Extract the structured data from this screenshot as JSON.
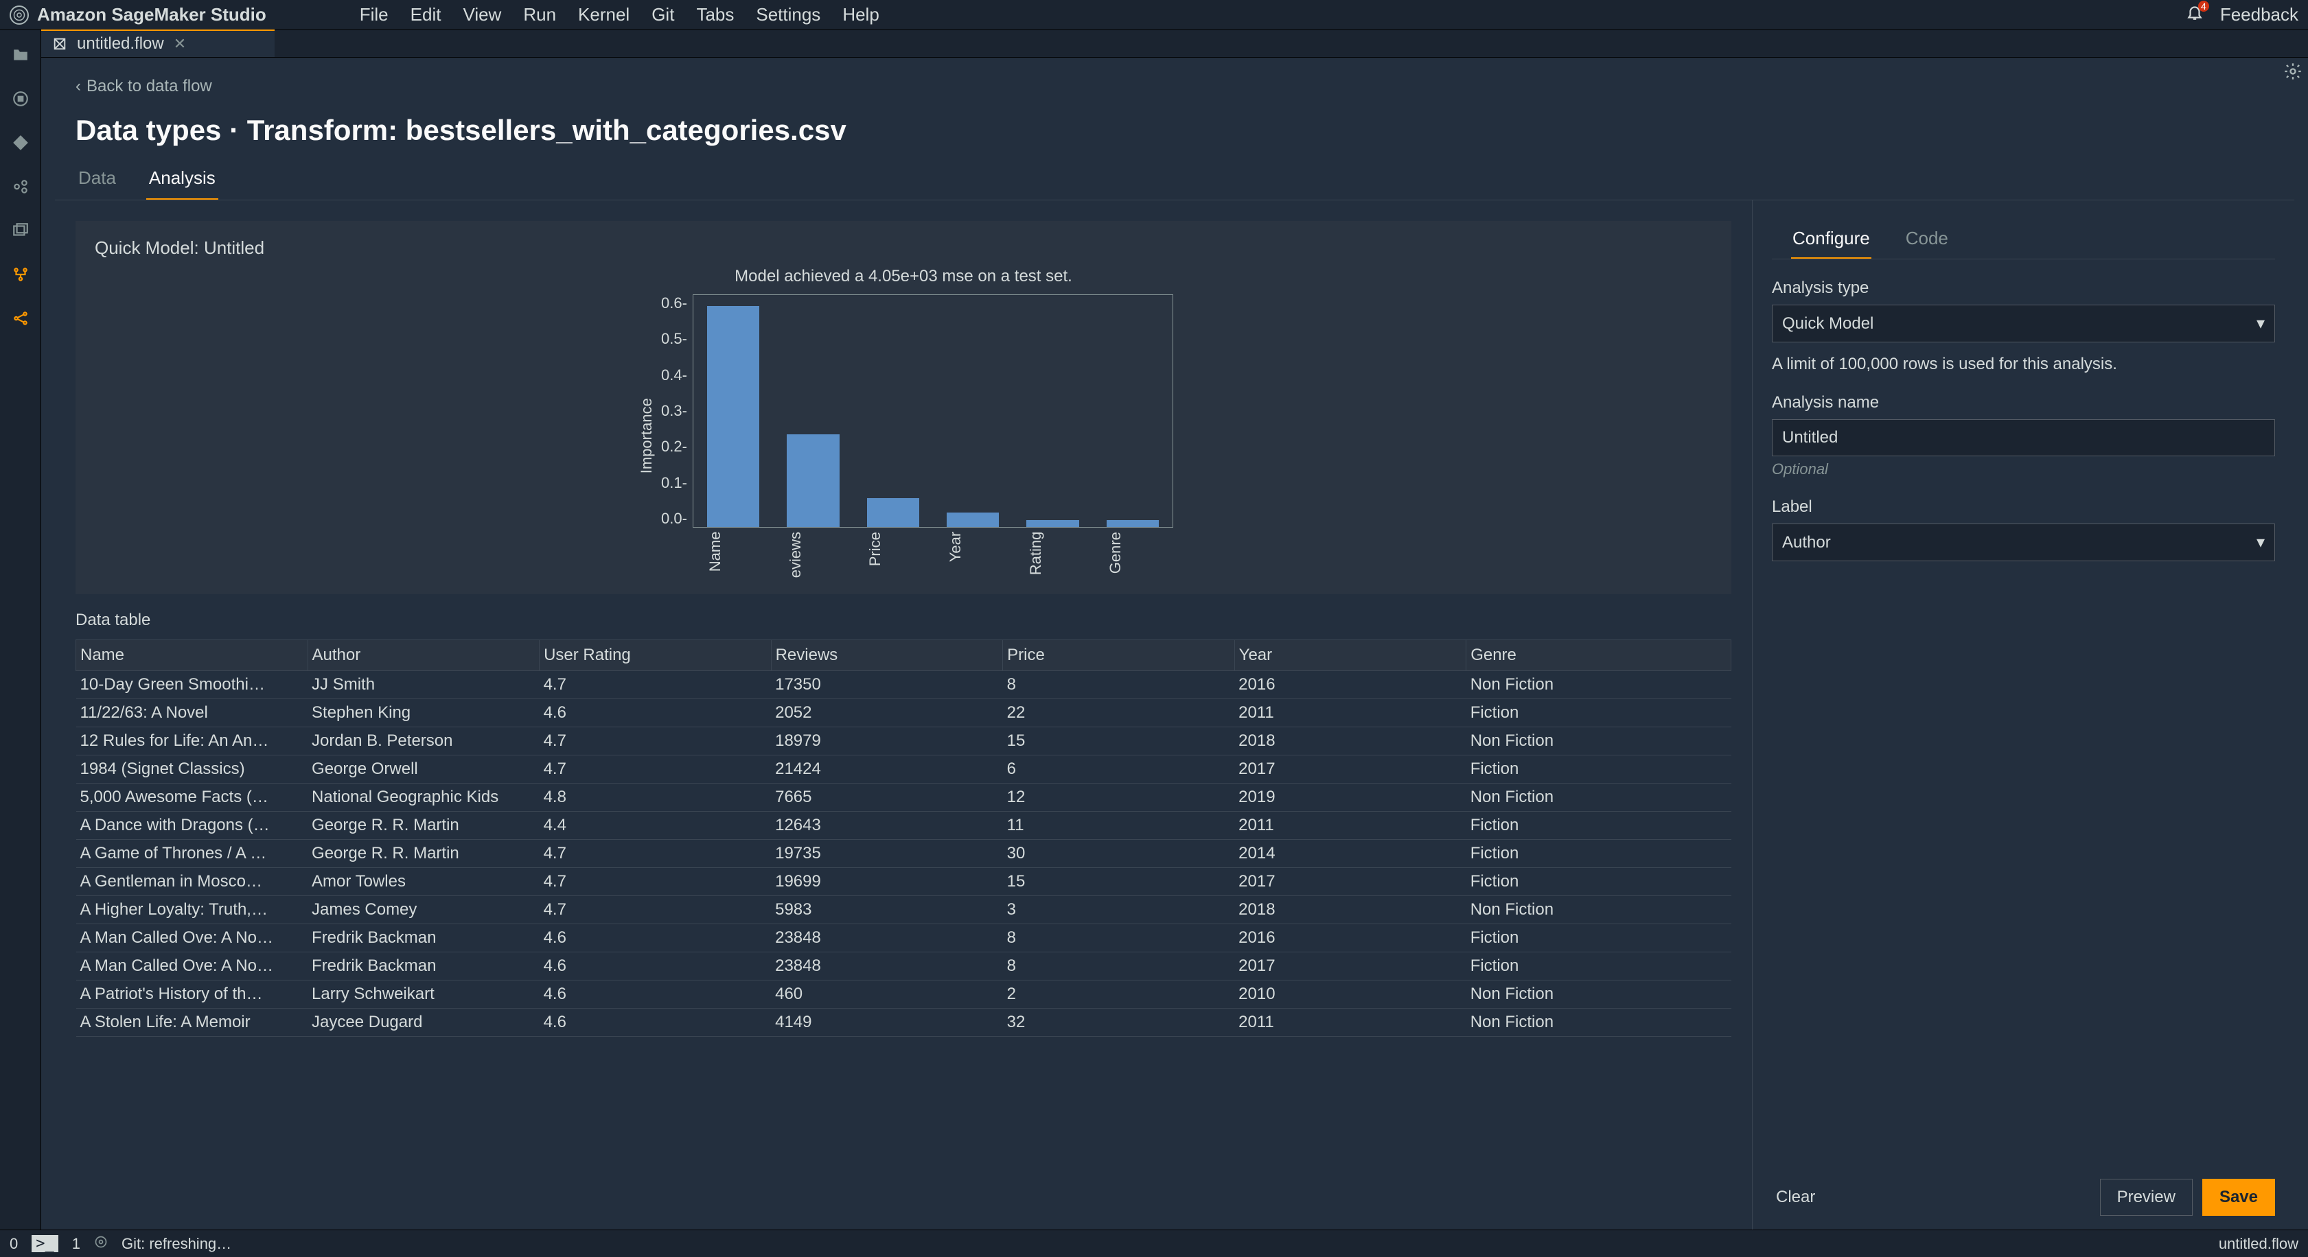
{
  "menubar": {
    "app_title": "Amazon SageMaker Studio",
    "items": [
      "File",
      "Edit",
      "View",
      "Run",
      "Kernel",
      "Git",
      "Tabs",
      "Settings",
      "Help"
    ],
    "notif_count": "4",
    "feedback": "Feedback"
  },
  "tab": {
    "label": "untitled.flow"
  },
  "backlink": "Back to data flow",
  "page_title": "Data types · Transform: bestsellers_with_categories.csv",
  "subtabs": {
    "data": "Data",
    "analysis": "Analysis"
  },
  "quick_model_title": "Quick Model: Untitled",
  "chart_caption": "Model achieved a 4.05e+03 mse on a test set.",
  "chart_data": {
    "type": "bar",
    "categories": [
      "Name",
      "eviews",
      "Price",
      "Year",
      "Rating",
      "Genre"
    ],
    "values": [
      0.62,
      0.26,
      0.08,
      0.04,
      0.02,
      0.02
    ],
    "ylabel": "Importance",
    "ylim": [
      0.0,
      0.6
    ],
    "yticks": [
      "0.6-",
      "0.5-",
      "0.4-",
      "0.3-",
      "0.2-",
      "0.1-",
      "0.0-"
    ]
  },
  "data_table_label": "Data table",
  "columns": [
    "Name",
    "Author",
    "User Rating",
    "Reviews",
    "Price",
    "Year",
    "Genre"
  ],
  "rows": [
    [
      "10-Day Green Smoothi…",
      "JJ Smith",
      "4.7",
      "17350",
      "8",
      "2016",
      "Non Fiction"
    ],
    [
      "11/22/63: A Novel",
      "Stephen King",
      "4.6",
      "2052",
      "22",
      "2011",
      "Fiction"
    ],
    [
      "12 Rules for Life: An An…",
      "Jordan B. Peterson",
      "4.7",
      "18979",
      "15",
      "2018",
      "Non Fiction"
    ],
    [
      "1984 (Signet Classics)",
      "George Orwell",
      "4.7",
      "21424",
      "6",
      "2017",
      "Fiction"
    ],
    [
      "5,000 Awesome Facts (…",
      "National Geographic Kids",
      "4.8",
      "7665",
      "12",
      "2019",
      "Non Fiction"
    ],
    [
      "A Dance with Dragons (…",
      "George R. R. Martin",
      "4.4",
      "12643",
      "11",
      "2011",
      "Fiction"
    ],
    [
      "A Game of Thrones / A …",
      "George R. R. Martin",
      "4.7",
      "19735",
      "30",
      "2014",
      "Fiction"
    ],
    [
      "A Gentleman in Mosco…",
      "Amor Towles",
      "4.7",
      "19699",
      "15",
      "2017",
      "Fiction"
    ],
    [
      "A Higher Loyalty: Truth,…",
      "James Comey",
      "4.7",
      "5983",
      "3",
      "2018",
      "Non Fiction"
    ],
    [
      "A Man Called Ove: A No…",
      "Fredrik Backman",
      "4.6",
      "23848",
      "8",
      "2016",
      "Fiction"
    ],
    [
      "A Man Called Ove: A No…",
      "Fredrik Backman",
      "4.6",
      "23848",
      "8",
      "2017",
      "Fiction"
    ],
    [
      "A Patriot's History of th…",
      "Larry Schweikart",
      "4.6",
      "460",
      "2",
      "2010",
      "Non Fiction"
    ],
    [
      "A Stolen Life: A Memoir",
      "Jaycee Dugard",
      "4.6",
      "4149",
      "32",
      "2011",
      "Non Fiction"
    ]
  ],
  "config": {
    "tabs": {
      "configure": "Configure",
      "code": "Code"
    },
    "analysis_type_label": "Analysis type",
    "analysis_type_value": "Quick Model",
    "rows_limit_text": "A limit of 100,000 rows is used for this analysis.",
    "analysis_name_label": "Analysis name",
    "analysis_name_value": "Untitled",
    "optional": "Optional",
    "label_label": "Label",
    "label_value": "Author",
    "clear": "Clear",
    "preview": "Preview",
    "save": "Save"
  },
  "status": {
    "left_num": "0",
    "term": "1",
    "git": "Git: refreshing…",
    "right": "untitled.flow"
  }
}
